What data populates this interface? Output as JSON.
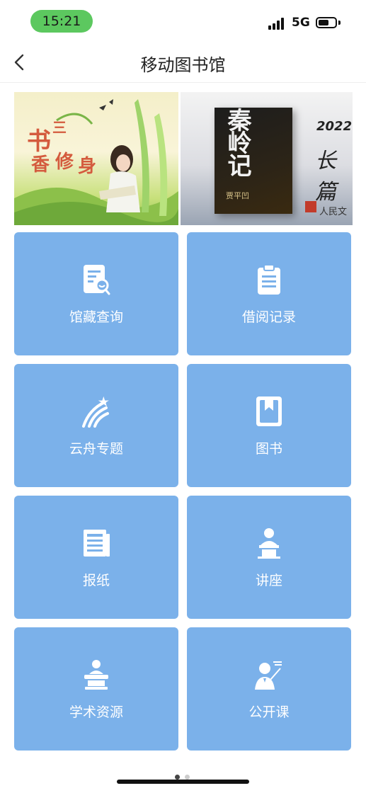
{
  "status_bar": {
    "time": "15:21",
    "network": "5G",
    "time_pill_color": "#5cc85f"
  },
  "nav": {
    "title": "移动图书馆",
    "back_icon": "chevron-left-icon"
  },
  "banner": {
    "left": {
      "char_1": "书",
      "char_2": "香",
      "char_3": "修",
      "char_4": "身",
      "char_5": "三"
    },
    "right": {
      "book_title": "秦岭记",
      "author": "贾平凹",
      "year": "2022",
      "text": "长篇",
      "publisher": "人民文"
    }
  },
  "tiles": [
    {
      "label": "馆藏查询",
      "icon": "catalog-search-icon"
    },
    {
      "label": "借阅记录",
      "icon": "clipboard-icon"
    },
    {
      "label": "云舟专题",
      "icon": "comet-icon"
    },
    {
      "label": "图书",
      "icon": "book-icon"
    },
    {
      "label": "报纸",
      "icon": "newspaper-icon"
    },
    {
      "label": "讲座",
      "icon": "lecture-podium-icon"
    },
    {
      "label": "学术资源",
      "icon": "speaker-podium-icon"
    },
    {
      "label": "公开课",
      "icon": "teacher-board-icon"
    }
  ],
  "colors": {
    "tile_bg": "#7bb1ea",
    "tile_text": "#ffffff"
  },
  "pager": {
    "current": 1,
    "total": 2
  }
}
